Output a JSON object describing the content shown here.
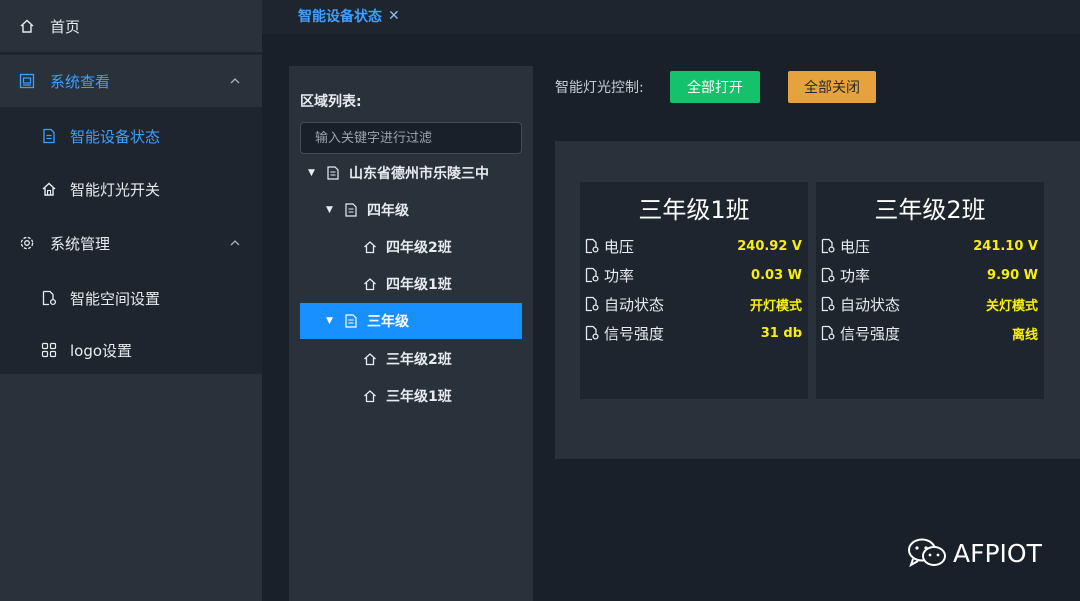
{
  "sidebar": {
    "home": "首页",
    "system_view": "系统查看",
    "device_status": "智能设备状态",
    "light_switch": "智能灯光开关",
    "system_mgmt": "系统管理",
    "space_settings": "智能空间设置",
    "logo_settings": "logo设置"
  },
  "tabs": [
    {
      "label": "智能设备状态"
    }
  ],
  "tree": {
    "title": "区域列表:",
    "filter_placeholder": "输入关键字进行过滤",
    "nodes": [
      {
        "label": "山东省德州市乐陵三中"
      },
      {
        "label": "四年级"
      },
      {
        "label": "四年级2班"
      },
      {
        "label": "四年级1班"
      },
      {
        "label": "三年级"
      },
      {
        "label": "三年级2班"
      },
      {
        "label": "三年级1班"
      }
    ]
  },
  "light_control": {
    "label": "智能灯光控制:",
    "open_all": "全部打开",
    "close_all": "全部关闭"
  },
  "cards": [
    {
      "title": "三年级1班",
      "rows": [
        {
          "label": "电压",
          "value": "240.92 V"
        },
        {
          "label": "功率",
          "value": "0.03 W"
        },
        {
          "label": "自动状态",
          "value": "开灯模式"
        },
        {
          "label": "信号强度",
          "value": "31 db"
        }
      ]
    },
    {
      "title": "三年级2班",
      "rows": [
        {
          "label": "电压",
          "value": "241.10 V"
        },
        {
          "label": "功率",
          "value": "9.90 W"
        },
        {
          "label": "自动状态",
          "value": "关灯模式"
        },
        {
          "label": "信号强度",
          "value": "离线"
        }
      ]
    }
  ],
  "watermark": "AFPIOT",
  "colors": {
    "accent": "#409eff",
    "selected": "#1890ff",
    "open_button": "#13c26b",
    "close_button": "#e6a23c",
    "value_text": "#f7ef12"
  }
}
